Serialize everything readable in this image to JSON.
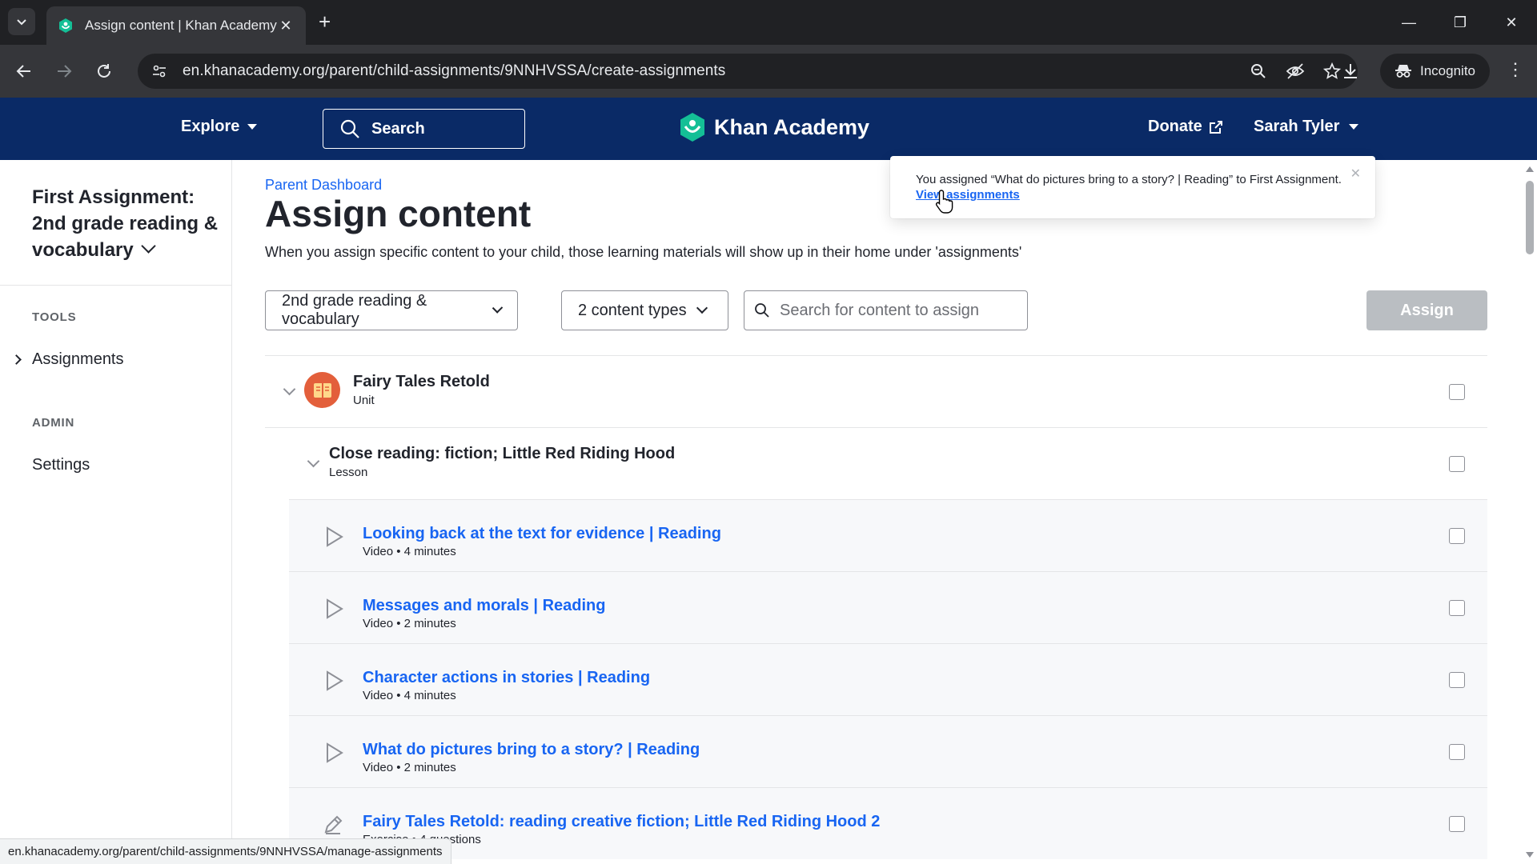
{
  "browser": {
    "tab_title": "Assign content | Khan Academy",
    "url": "en.khanacademy.org/parent/child-assignments/9NNHVSSA/create-assignments",
    "incognito_label": "Incognito",
    "status_url": "en.khanacademy.org/parent/child-assignments/9NNHVSSA/manage-assignments"
  },
  "header": {
    "explore": "Explore",
    "search": "Search",
    "logo": "Khan Academy",
    "donate": "Donate",
    "user": "Sarah Tyler"
  },
  "sidebar": {
    "child_title": "First Assignment: 2nd grade reading & vocabulary",
    "tools_heading": "TOOLS",
    "assignments": "Assignments",
    "admin_heading": "ADMIN",
    "settings": "Settings"
  },
  "main": {
    "breadcrumb": "Parent Dashboard",
    "title": "Assign content",
    "description": "When you assign specific content to your child, those learning materials will show up in their home under 'assignments'",
    "course_dropdown": "2nd grade reading & vocabulary",
    "content_types_dropdown": "2 content types",
    "search_placeholder": "Search for content to assign",
    "assign_button": "Assign"
  },
  "content": {
    "unit": {
      "title": "Fairy Tales Retold",
      "type": "Unit"
    },
    "lesson": {
      "title": "Close reading: fiction; Little Red Riding Hood",
      "type": "Lesson"
    },
    "items": [
      {
        "title": "Looking back at the text for evidence | Reading",
        "meta": "Video • 4 minutes",
        "kind": "video"
      },
      {
        "title": "Messages and morals | Reading",
        "meta": "Video • 2 minutes",
        "kind": "video"
      },
      {
        "title": "Character actions in stories | Reading",
        "meta": "Video • 4 minutes",
        "kind": "video"
      },
      {
        "title": "What do pictures bring to a story? | Reading",
        "meta": "Video • 2 minutes",
        "kind": "video"
      },
      {
        "title": "Fairy Tales Retold: reading creative fiction; Little Red Riding Hood 2",
        "meta": "Exercise • 4 questions",
        "kind": "exercise"
      }
    ]
  },
  "toast": {
    "message": "You assigned “What do pictures bring to a story? | Reading” to First Assignment.",
    "link": "View assignments"
  },
  "colors": {
    "header_bg": "#0a2a66",
    "link_blue": "#1865f2",
    "ka_green": "#14bf96",
    "unit_icon": "#e35f3b",
    "assign_disabled": "#babec2"
  }
}
